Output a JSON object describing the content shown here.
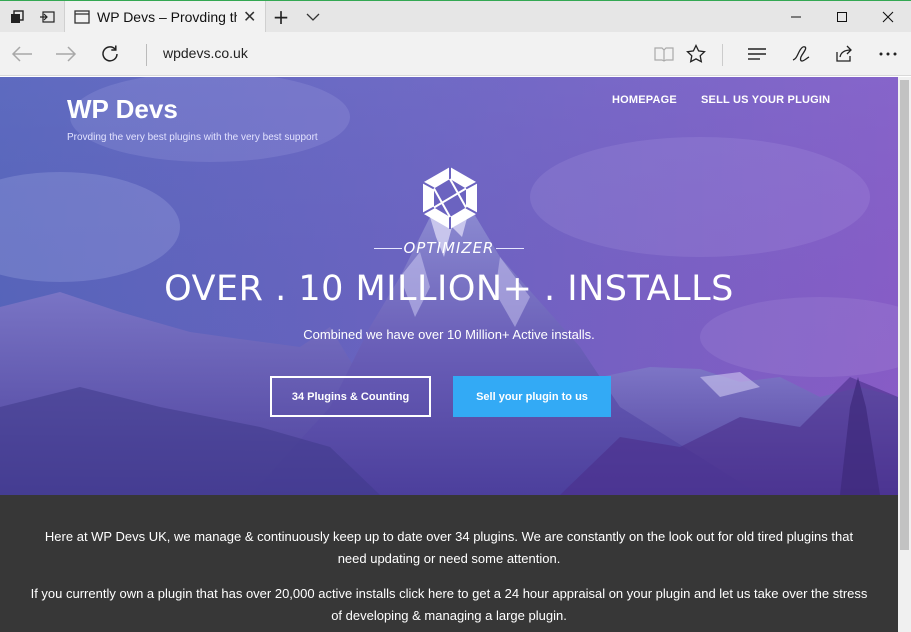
{
  "browser": {
    "tab_title": "WP Devs – Provding the",
    "tab_close": "✕",
    "new_tab": "+",
    "tab_list": "⌵",
    "url": "wpdevs.co.uk"
  },
  "site": {
    "title": "WP Devs",
    "tagline": "Provding the very best plugins with the very best support",
    "nav": [
      "HOMEPAGE",
      "SELL US YOUR PLUGIN"
    ]
  },
  "hero": {
    "badge": "OPTIMIZER",
    "headline": "OVER . 10 MILLION+ . INSTALLS",
    "subline": "Combined we have over 10 Million+ Active installs.",
    "button_primary": "34 Plugins & Counting",
    "button_secondary": "Sell your plugin to us"
  },
  "content": {
    "paragraph_1": "Here at WP Devs UK, we manage & continuously keep up to date over 34 plugins. We are constantly on the look out for old tired plugins that need updating or need some attention.",
    "paragraph_2": "If you currently own a plugin that has over 20,000 active installs click here to get a 24 hour appraisal on your plugin and let us take over the stress of developing & managing a large plugin."
  },
  "colors": {
    "hero_gradient_start": "#5464b8",
    "hero_gradient_end": "#8a5cc6",
    "cta_blue": "#33aaf5",
    "content_bg": "#373737"
  },
  "icons": [
    "tab-manager-icon",
    "set-aside-tabs-icon",
    "page-icon",
    "close-icon",
    "new-tab-icon",
    "tab-list-icon",
    "minimize-icon",
    "maximize-icon",
    "window-close-icon",
    "back-arrow-icon",
    "forward-arrow-icon",
    "refresh-icon",
    "reading-view-icon",
    "favorite-star-icon",
    "hub-icon",
    "web-note-icon",
    "share-icon",
    "more-icon",
    "hexagon-logo-icon"
  ]
}
